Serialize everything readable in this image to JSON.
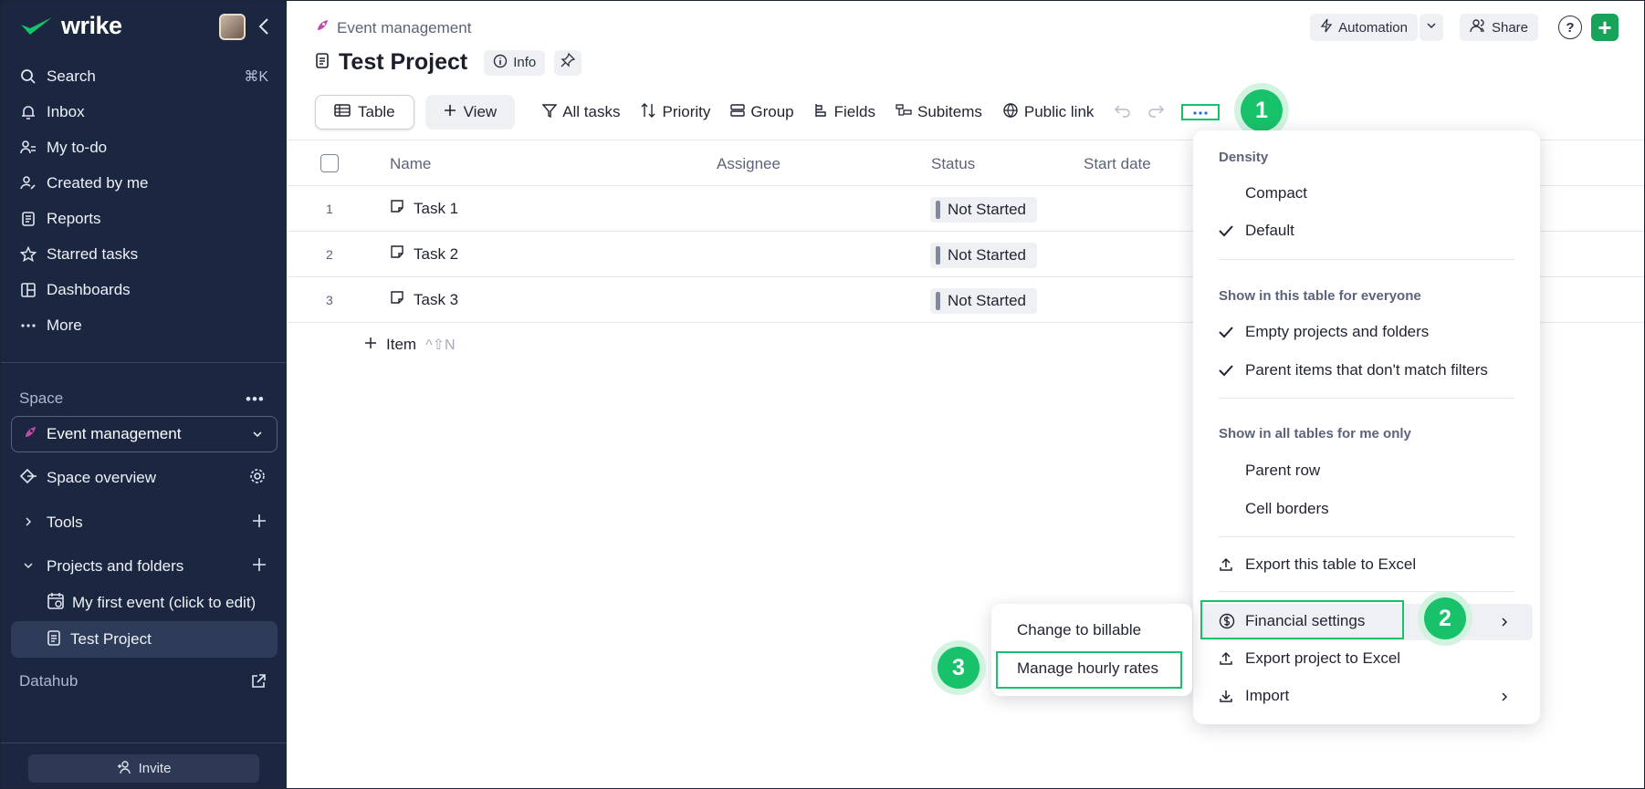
{
  "app": {
    "name": "wrike"
  },
  "sidebar": {
    "nav": [
      {
        "label": "Search",
        "shortcut": "⌘K"
      },
      {
        "label": "Inbox"
      },
      {
        "label": "My to-do"
      },
      {
        "label": "Created by me"
      },
      {
        "label": "Reports"
      },
      {
        "label": "Starred tasks"
      },
      {
        "label": "Dashboards"
      },
      {
        "label": "More"
      }
    ],
    "space_label": "Space",
    "space_select": "Event management",
    "space_overview": "Space overview",
    "tools": "Tools",
    "projects_folders": "Projects and folders",
    "tree": [
      {
        "label": "My first event (click to edit)"
      },
      {
        "label": "Test Project"
      }
    ],
    "datahub": "Datahub",
    "invite": "Invite"
  },
  "header": {
    "breadcrumb": "Event management",
    "title": "Test Project",
    "info": "Info",
    "automation": "Automation",
    "share": "Share",
    "help": "?"
  },
  "toolbar": {
    "table": "Table",
    "view": "View",
    "all_tasks": "All tasks",
    "priority": "Priority",
    "group": "Group",
    "fields": "Fields",
    "subitems": "Subitems",
    "public_link": "Public link"
  },
  "table": {
    "columns": [
      "Name",
      "Assignee",
      "Status",
      "Start date"
    ],
    "rows": [
      {
        "num": "1",
        "name": "Task 1",
        "status": "Not Started"
      },
      {
        "num": "2",
        "name": "Task 2",
        "status": "Not Started"
      },
      {
        "num": "3",
        "name": "Task 3",
        "status": "Not Started"
      }
    ],
    "add_item": "Item",
    "add_shortcut": "^⇧N"
  },
  "menu": {
    "density_title": "Density",
    "compact": "Compact",
    "default": "Default",
    "everyone_title": "Show in this table for everyone",
    "empty_projects": "Empty projects and folders",
    "parent_items": "Parent items that don't match filters",
    "me_title": "Show in all tables for me only",
    "parent_row": "Parent row",
    "cell_borders": "Cell borders",
    "export_table": "Export this table to Excel",
    "financial": "Financial settings",
    "export_project": "Export project to Excel",
    "import": "Import"
  },
  "submenu": {
    "change_billable": "Change to billable",
    "manage_rates": "Manage hourly rates"
  },
  "steps": {
    "one": "1",
    "two": "2",
    "three": "3"
  },
  "colors": {
    "sidebar_bg": "#1b2740",
    "accent_green": "#18c26a",
    "brand_green": "#18a35a"
  }
}
